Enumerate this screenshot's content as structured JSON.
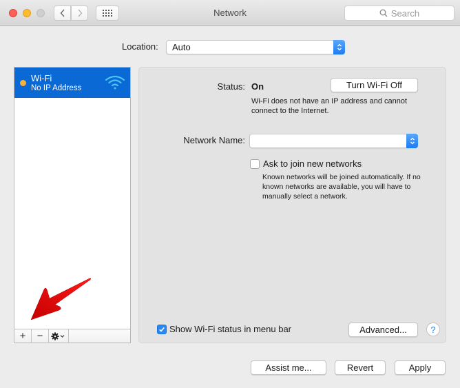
{
  "window": {
    "title": "Network",
    "search_placeholder": "Search",
    "nav": {
      "back_icon": "chevron-left-icon",
      "forward_icon": "chevron-right-icon",
      "grid_icon": "show-all-grid-icon"
    }
  },
  "location": {
    "label": "Location:",
    "value": "Auto"
  },
  "sidebar": {
    "services": [
      {
        "name": "Wi-Fi",
        "status": "No IP Address",
        "status_color": "#f6b23c",
        "selected": true,
        "icon": "wifi-icon"
      }
    ],
    "toolbar": {
      "add_label": "+",
      "remove_label": "−",
      "gear_icon": "gear-icon"
    }
  },
  "detail": {
    "status_label": "Status:",
    "status_value": "On",
    "turn_off_button": "Turn Wi-Fi Off",
    "status_description": "Wi-Fi does not have an IP address and cannot connect to the Internet.",
    "network_name_label": "Network Name:",
    "network_name_value": "",
    "ask_to_join_label": "Ask to join new networks",
    "ask_to_join_checked": false,
    "ask_to_join_description": "Known networks will be joined automatically. If no known networks are available, you will have to manually select a network.",
    "show_status_label": "Show Wi-Fi status in menu bar",
    "show_status_checked": true,
    "advanced_button": "Advanced...",
    "help_label": "?"
  },
  "footer": {
    "assist_button": "Assist me...",
    "revert_button": "Revert",
    "apply_button": "Apply"
  },
  "colors": {
    "accent": "#0b69d6",
    "annotation_arrow": "#e00000"
  }
}
